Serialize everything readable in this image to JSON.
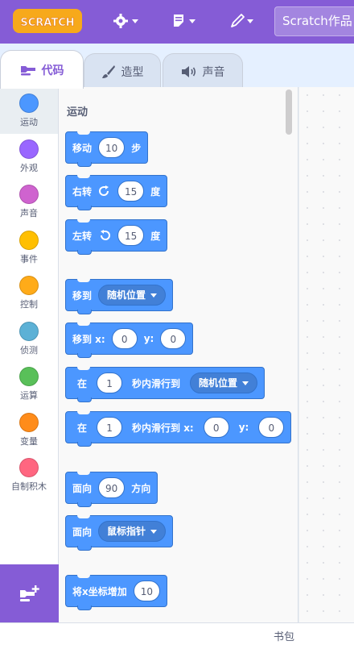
{
  "app": {
    "logo_text": "SCRATCH",
    "project_title": "Scratch作品",
    "accent_color": "#855cd6"
  },
  "menu": {
    "settings_icon": "gear-icon",
    "file_icon": "file-icon",
    "edit_icon": "pencil-icon"
  },
  "tabs": [
    {
      "label": "代码",
      "icon": "code-icon",
      "active": true
    },
    {
      "label": "造型",
      "icon": "brush-icon",
      "active": false
    },
    {
      "label": "声音",
      "icon": "speaker-icon",
      "active": false
    }
  ],
  "categories": [
    {
      "label": "运动",
      "color": "#4c97ff",
      "selected": true
    },
    {
      "label": "外观",
      "color": "#9966ff"
    },
    {
      "label": "声音",
      "color": "#cf63cf"
    },
    {
      "label": "事件",
      "color": "#ffbf00"
    },
    {
      "label": "控制",
      "color": "#ffab19"
    },
    {
      "label": "侦测",
      "color": "#5cb1d6"
    },
    {
      "label": "运算",
      "color": "#59c059"
    },
    {
      "label": "变量",
      "color": "#ff8c1a"
    },
    {
      "label": "自制积木",
      "color": "#ff6680"
    }
  ],
  "extension_button_icon": "add-extension-icon",
  "flyout": {
    "title": "运动",
    "blocks": {
      "move": {
        "text": "移动",
        "value": "10",
        "suffix": "步"
      },
      "turn_right": {
        "text": "右转",
        "value": "15",
        "suffix": "度"
      },
      "turn_left": {
        "text": "左转",
        "value": "15",
        "suffix": "度"
      },
      "goto": {
        "text": "移到",
        "menu": "随机位置"
      },
      "goto_xy": {
        "text": "移到 x:",
        "x": "0",
        "y_label": "y:",
        "y": "0"
      },
      "glide_to": {
        "prefix": "在",
        "secs": "1",
        "text": "秒内滑行到",
        "menu": "随机位置"
      },
      "glide_xy": {
        "prefix": "在",
        "secs": "1",
        "text": "秒内滑行到 x:",
        "x": "0",
        "y_label": "y:",
        "y": "0"
      },
      "point_dir": {
        "text": "面向",
        "value": "90",
        "suffix": "方向"
      },
      "point_towards": {
        "text": "面向",
        "menu": "鼠标指针"
      },
      "change_x": {
        "text": "将x坐标增加",
        "value": "10"
      }
    }
  },
  "backpack": {
    "label": "书包"
  }
}
